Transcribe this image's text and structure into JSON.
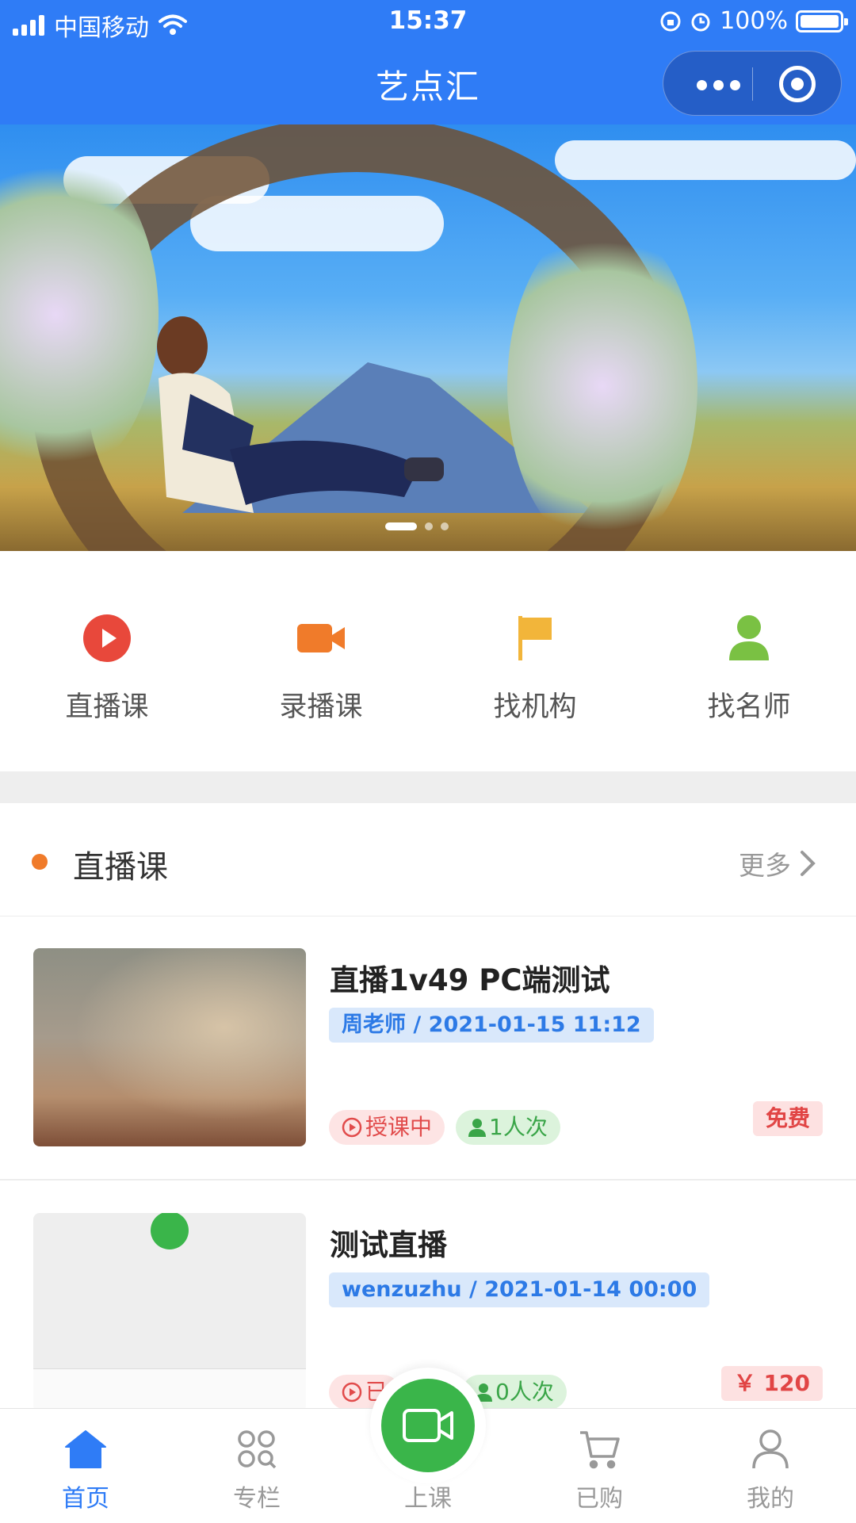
{
  "status_bar": {
    "carrier": "中国移动",
    "time": "15:37",
    "battery": "100%"
  },
  "nav": {
    "title": "艺点汇"
  },
  "banner": {
    "slide_count": 3,
    "active_slide": 1
  },
  "quick_menu": [
    {
      "label": "直播课",
      "icon": "play-circle-icon",
      "color": "#e8483b"
    },
    {
      "label": "录播课",
      "icon": "video-camera-icon",
      "color": "#f07b2a"
    },
    {
      "label": "找机构",
      "icon": "flag-icon",
      "color": "#f2b53a"
    },
    {
      "label": "找名师",
      "icon": "person-icon",
      "color": "#7ac143"
    }
  ],
  "section": {
    "title": "直播课",
    "more": "更多"
  },
  "courses": [
    {
      "title": "直播1v49 PC端测试",
      "meta": "周老师 / 2021-01-15 11:12",
      "status": "授课中",
      "count": "1人次",
      "price": "免费"
    },
    {
      "title": "测试直播",
      "meta": "wenzuzhu / 2021-01-14 00:00",
      "status": "已",
      "count": "0人次",
      "price": "￥ 120"
    }
  ],
  "tabbar": {
    "tabs": [
      {
        "label": "首页",
        "icon": "home-icon",
        "active": true
      },
      {
        "label": "专栏",
        "icon": "grid-search-icon",
        "active": false
      },
      {
        "label": "上课",
        "icon": "video-camera-icon",
        "active": false
      },
      {
        "label": "已购",
        "icon": "cart-icon",
        "active": false
      },
      {
        "label": "我的",
        "icon": "user-icon",
        "active": false
      }
    ]
  },
  "colors": {
    "brand_blue": "#2f7cf6",
    "live_green": "#3ab54a",
    "price_red": "#e14545"
  }
}
